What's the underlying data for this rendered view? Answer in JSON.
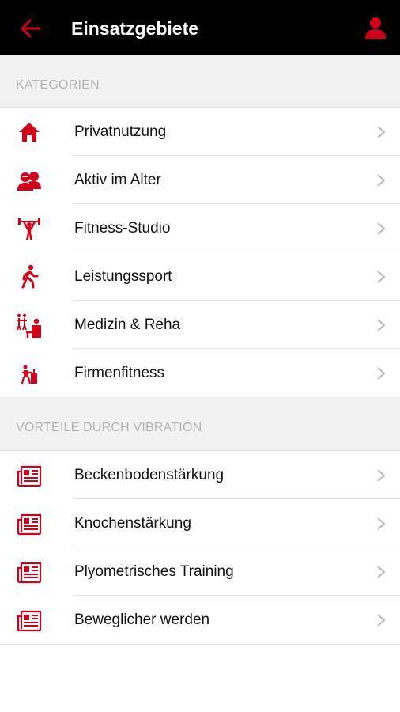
{
  "header": {
    "title": "Einsatzgebiete"
  },
  "kategorien": {
    "heading": "KATEGORIEN",
    "items": [
      {
        "label": "Privatnutzung",
        "icon": "home-icon"
      },
      {
        "label": "Aktiv im Alter",
        "icon": "seniors-icon"
      },
      {
        "label": "Fitness-Studio",
        "icon": "weightlifter-icon"
      },
      {
        "label": "Leistungssport",
        "icon": "walking-person-icon"
      },
      {
        "label": "Medizin & Reha",
        "icon": "medical-rehab-icon"
      },
      {
        "label": "Firmenfitness",
        "icon": "office-fitness-icon"
      }
    ]
  },
  "vorteile": {
    "heading": "VORTEILE DURCH VIBRATION",
    "items": [
      {
        "label": "Beckenbodenstärkung",
        "icon": "article-icon"
      },
      {
        "label": "Knochenstärkung",
        "icon": "article-icon"
      },
      {
        "label": "Plyometrisches Training",
        "icon": "article-icon"
      },
      {
        "label": "Beweglicher werden",
        "icon": "article-icon"
      }
    ]
  },
  "colors": {
    "accent": "#d0021b",
    "header_bg": "#000000",
    "section_bg": "#f2f2f2"
  }
}
